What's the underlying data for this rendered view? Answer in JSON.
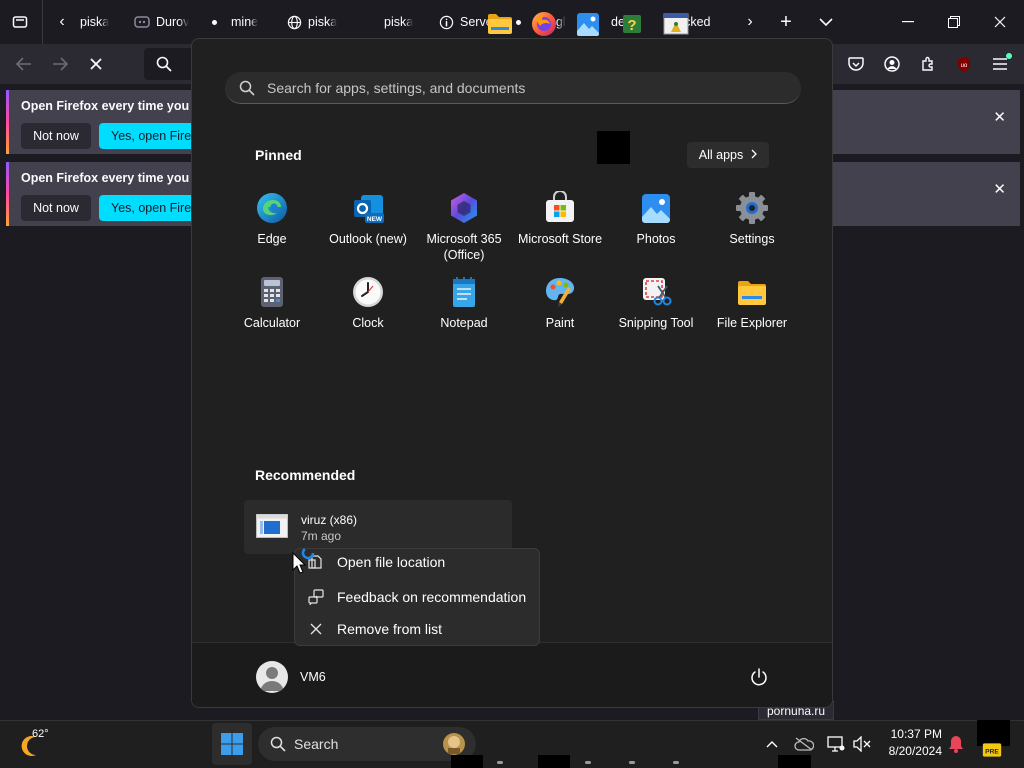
{
  "tabs": [
    {
      "label": "piska",
      "type": "label"
    },
    {
      "label": "Durov",
      "type": "icon"
    },
    {
      "label": "mine",
      "type": "dot"
    },
    {
      "label": "piska",
      "type": "globe"
    },
    {
      "label": "piska",
      "type": "label"
    },
    {
      "label": "Server",
      "type": "info"
    },
    {
      "label": "googl",
      "type": "dot"
    },
    {
      "label": "deng",
      "type": "dot"
    },
    {
      "label": "Blocked",
      "type": "label"
    }
  ],
  "notifications": [
    {
      "text": "Open Firefox every time you re",
      "not_now": "Not now",
      "yes": "Yes, open Firefox"
    },
    {
      "text": "Open Firefox every time you re",
      "not_now": "Not now",
      "yes": "Yes, open Firefox"
    }
  ],
  "status_text": "pornuha.ru",
  "start_menu": {
    "search_placeholder": "Search for apps, settings, and documents",
    "pinned_label": "Pinned",
    "all_apps_label": "All apps",
    "pinned_apps": [
      {
        "name": "Edge",
        "icon": "edge-icon"
      },
      {
        "name": "Outlook (new)",
        "icon": "outlook-icon"
      },
      {
        "name": "Microsoft 365 (Office)",
        "icon": "m365-icon"
      },
      {
        "name": "Microsoft Store",
        "icon": "store-icon"
      },
      {
        "name": "Photos",
        "icon": "photos-icon"
      },
      {
        "name": "Settings",
        "icon": "settings-icon"
      },
      {
        "name": "Calculator",
        "icon": "calculator-icon"
      },
      {
        "name": "Clock",
        "icon": "clock-icon"
      },
      {
        "name": "Notepad",
        "icon": "notepad-icon"
      },
      {
        "name": "Paint",
        "icon": "paint-icon"
      },
      {
        "name": "Snipping Tool",
        "icon": "snipping-icon"
      },
      {
        "name": "File Explorer",
        "icon": "explorer-icon"
      }
    ],
    "recommended_label": "Recommended",
    "recommended": [
      {
        "name": "viruz (x86)",
        "time": "7m ago"
      }
    ],
    "user": "VM6"
  },
  "context_menu": [
    {
      "label": "Open file location",
      "icon": "folder-open-icon"
    },
    {
      "label": "Feedback on recommendation",
      "icon": "feedback-icon"
    },
    {
      "label": "Remove from list",
      "icon": "close-icon"
    }
  ],
  "taskbar": {
    "weather_temp": "62°",
    "search_label": "Search",
    "time": "10:37 PM",
    "date": "8/20/2024"
  }
}
